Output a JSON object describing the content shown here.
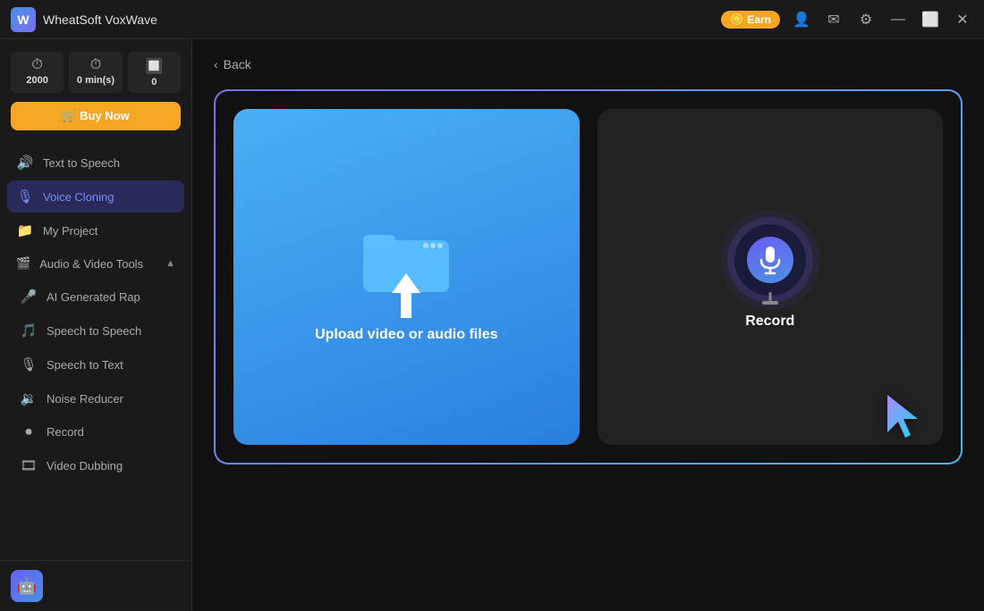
{
  "app": {
    "logo_letter": "W",
    "name": "WheatSoft VoxWave",
    "earn_label": "Earn"
  },
  "titlebar": {
    "icons": [
      "👤",
      "✉",
      "⚙",
      "—",
      "⬜",
      "✕"
    ]
  },
  "sidebar": {
    "stats": [
      {
        "id": "characters",
        "icon": "⏱",
        "value": "2000"
      },
      {
        "id": "minutes",
        "icon": "⏱",
        "value": "0 min(s)"
      },
      {
        "id": "count",
        "icon": "🔲",
        "value": "0"
      }
    ],
    "buy_label": "🛒  Buy Now",
    "nav_items": [
      {
        "id": "text-to-speech",
        "icon": "🔊",
        "label": "Text to Speech",
        "active": false
      },
      {
        "id": "voice-cloning",
        "icon": "🎙",
        "label": "Voice Cloning",
        "active": true
      },
      {
        "id": "my-project",
        "icon": "📁",
        "label": "My Project",
        "active": false
      }
    ],
    "av_section": {
      "label": "Audio & Video Tools",
      "icon": "🎬",
      "expanded": true,
      "sub_items": [
        {
          "id": "ai-rap",
          "icon": "🎤",
          "label": "AI Generated Rap"
        },
        {
          "id": "speech-to-speech",
          "icon": "🎵",
          "label": "Speech to Speech"
        },
        {
          "id": "speech-to-text",
          "icon": "🎙",
          "label": "Speech to Text"
        },
        {
          "id": "noise-reducer",
          "icon": "🔉",
          "label": "Noise Reducer"
        },
        {
          "id": "record",
          "icon": "⏺",
          "label": "Record"
        },
        {
          "id": "video-dubbing",
          "icon": "🎞",
          "label": "Video Dubbing"
        }
      ]
    }
  },
  "main": {
    "back_label": "Back",
    "upload_card": {
      "label": "Upload video or audio files"
    },
    "record_card": {
      "label": "Record"
    }
  }
}
